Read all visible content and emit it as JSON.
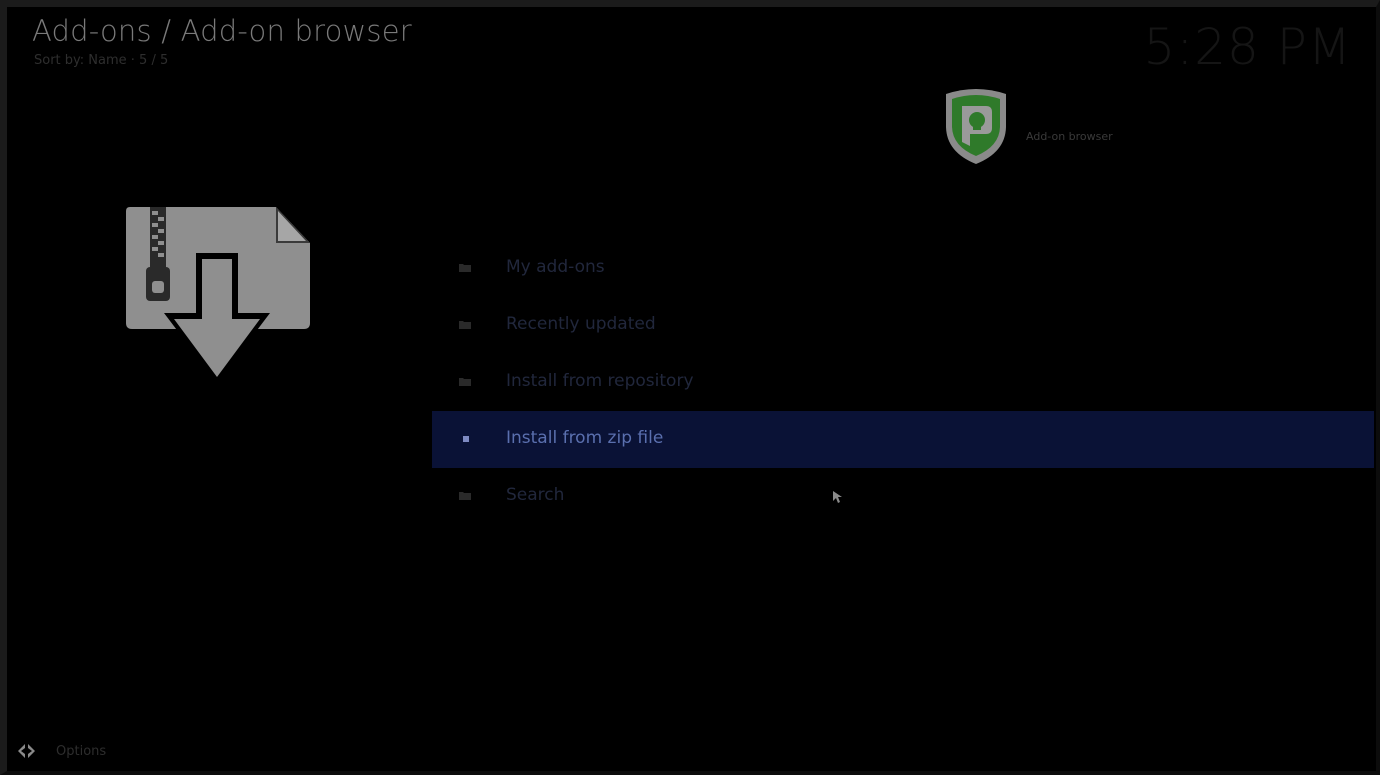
{
  "header": {
    "title": "Add-ons / Add-on browser",
    "subtitle": "Sort by: Name · 5 / 5"
  },
  "clock": {
    "time": "5:28 PM"
  },
  "branding": {
    "logo_icon": "purevpn-shield-icon",
    "label": "Add-on browser"
  },
  "preview": {
    "icon": "install-zip-icon"
  },
  "menu": {
    "items": [
      {
        "label": "My add-ons",
        "icon": "folder-icon",
        "active": false
      },
      {
        "label": "Recently updated",
        "icon": "folder-icon",
        "active": false
      },
      {
        "label": "Install from repository",
        "icon": "folder-icon",
        "active": false
      },
      {
        "label": "Install from zip file",
        "icon": "dot-icon",
        "active": true
      },
      {
        "label": "Search",
        "icon": "folder-icon",
        "active": false
      }
    ]
  },
  "footer": {
    "options_label": "Options",
    "options_icon": "options-arrows-icon"
  },
  "colors": {
    "background": "#000000",
    "selection": "#0a1236",
    "active_text": "#5a6fae",
    "logo_green": "#2f7a2a"
  }
}
